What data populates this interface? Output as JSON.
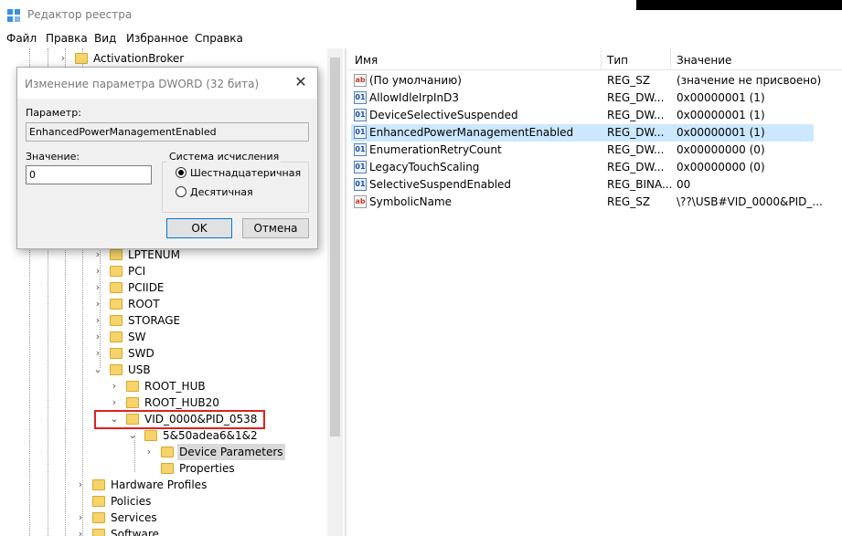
{
  "window": {
    "title": "Редактор реестра"
  },
  "menu": [
    "Файл",
    "Правка",
    "Вид",
    "Избранное",
    "Справка"
  ],
  "tree": {
    "items": [
      {
        "label": "ActivationBroker"
      },
      {
        "label": "LPTENUM"
      },
      {
        "label": "PCI"
      },
      {
        "label": "PCIIDE"
      },
      {
        "label": "ROOT"
      },
      {
        "label": "STORAGE"
      },
      {
        "label": "SW"
      },
      {
        "label": "SWD"
      },
      {
        "label": "USB"
      },
      {
        "label": "ROOT_HUB"
      },
      {
        "label": "ROOT_HUB20"
      },
      {
        "label": "VID_0000&PID_0538"
      },
      {
        "label": "5&50adea6&1&2"
      },
      {
        "label": "Device Parameters"
      },
      {
        "label": "Properties"
      },
      {
        "label": "Hardware Profiles"
      },
      {
        "label": "Policies"
      },
      {
        "label": "Services"
      },
      {
        "label": "Software"
      }
    ]
  },
  "list": {
    "columns": {
      "name": "Имя",
      "type": "Тип",
      "value": "Значение"
    },
    "rows": [
      {
        "icon": "string-value-icon",
        "name": "(По умолчанию)",
        "type": "REG_SZ",
        "value": "(значение не присвоено)"
      },
      {
        "icon": "dword-value-icon",
        "name": "AllowIdleIrpInD3",
        "type": "REG_DW...",
        "value": "0x00000001 (1)"
      },
      {
        "icon": "dword-value-icon",
        "name": "DeviceSelectiveSuspended",
        "type": "REG_DW...",
        "value": "0x00000001 (1)"
      },
      {
        "icon": "dword-value-icon",
        "name": "EnhancedPowerManagementEnabled",
        "type": "REG_DW...",
        "value": "0x00000001 (1)"
      },
      {
        "icon": "dword-value-icon",
        "name": "EnumerationRetryCount",
        "type": "REG_DW...",
        "value": "0x00000000 (0)"
      },
      {
        "icon": "dword-value-icon",
        "name": "LegacyTouchScaling",
        "type": "REG_DW...",
        "value": "0x00000000 (0)"
      },
      {
        "icon": "dword-value-icon",
        "name": "SelectiveSuspendEnabled",
        "type": "REG_BINA...",
        "value": "00"
      },
      {
        "icon": "string-value-icon",
        "name": "SymbolicName",
        "type": "REG_SZ",
        "value": "\\??\\USB#VID_0000&PID_..."
      }
    ]
  },
  "dialog": {
    "title": "Изменение параметра DWORD (32 бита)",
    "param_label": "Параметр:",
    "param_value": "EnhancedPowerManagementEnabled",
    "value_label": "Значение:",
    "value_input": "0",
    "radix_label": "Система исчисления",
    "radix_hex": "Шестнадцатеричная",
    "radix_dec": "Десятичная",
    "ok": "OK",
    "cancel": "Отмена"
  },
  "colors": {
    "selection": "#cce8ff",
    "highlight_box": "#e02020",
    "folder": "#f6d36b"
  }
}
